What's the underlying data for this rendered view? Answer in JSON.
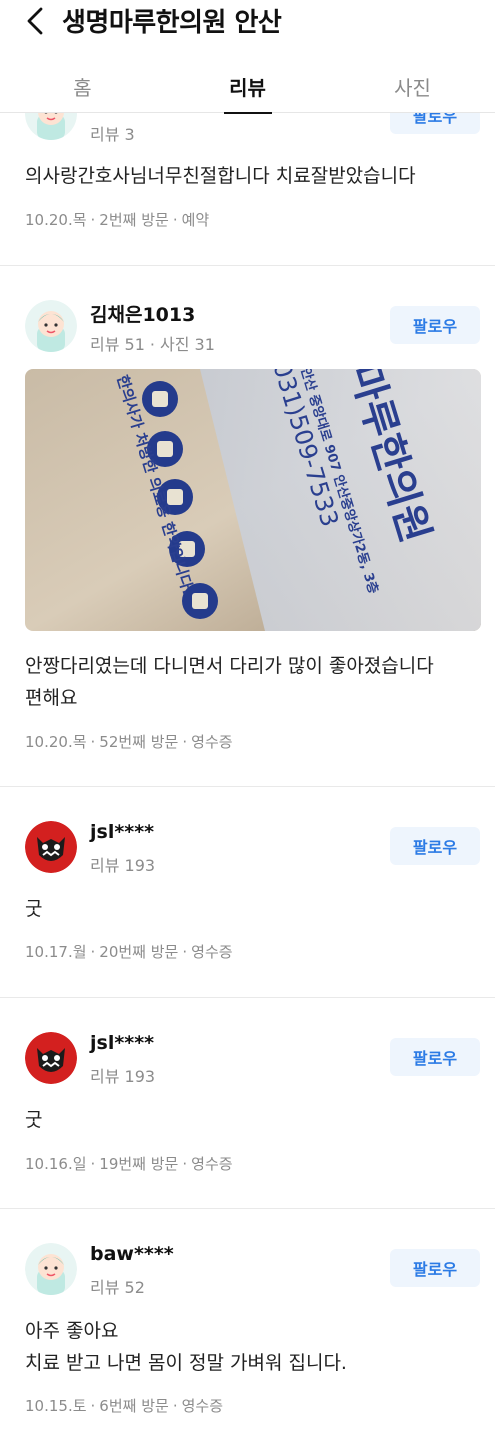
{
  "header": {
    "title": "생명마루한의원 안산",
    "tabs": [
      {
        "label": "홈"
      },
      {
        "label": "리뷰"
      },
      {
        "label": "사진"
      }
    ]
  },
  "reviews": [
    {
      "stats": "리뷰 3",
      "follow": "팔로우",
      "body": "의사랑간호사님너무친절합니다 치료잘받았습니다",
      "date": "10.20.목",
      "visit": "2번째 방문",
      "source": "예약"
    },
    {
      "nickname": "김채은1013",
      "stats": "리뷰 51",
      "stats2": "사진 31",
      "follow": "팔로우",
      "photo_text": {
        "phone": "031)509-7533",
        "address": "안산 중앙대로 907 안산중앙상가2동, 3층",
        "brand": "마루한의원",
        "note": "한의사가 처방한 의료용 한약입니다."
      },
      "body_line1": "안짱다리였는데 다니면서 다리가 많이 좋아졌습니다",
      "body_line2": "편해요",
      "date": "10.20.목",
      "visit": "52번째 방문",
      "source": "영수증"
    },
    {
      "nickname": "jsl****",
      "stats": "리뷰 193",
      "follow": "팔로우",
      "body": "굿",
      "date": "10.17.월",
      "visit": "20번째 방문",
      "source": "영수증"
    },
    {
      "nickname": "jsl****",
      "stats": "리뷰 193",
      "follow": "팔로우",
      "body": "굿",
      "date": "10.16.일",
      "visit": "19번째 방문",
      "source": "영수증"
    },
    {
      "nickname": "baw****",
      "stats": "리뷰 52",
      "follow": "팔로우",
      "body_line1": "아주 좋아요",
      "body_line2": "치료 받고 나면 몸이 정말 가벼워 집니다.",
      "date": "10.15.토",
      "visit": "6번째 방문",
      "source": "영수증"
    }
  ],
  "colors": {
    "follow_text": "#2c7be5",
    "follow_bg": "#eef5fd",
    "photo_text_blue": "#2a3f8f"
  }
}
